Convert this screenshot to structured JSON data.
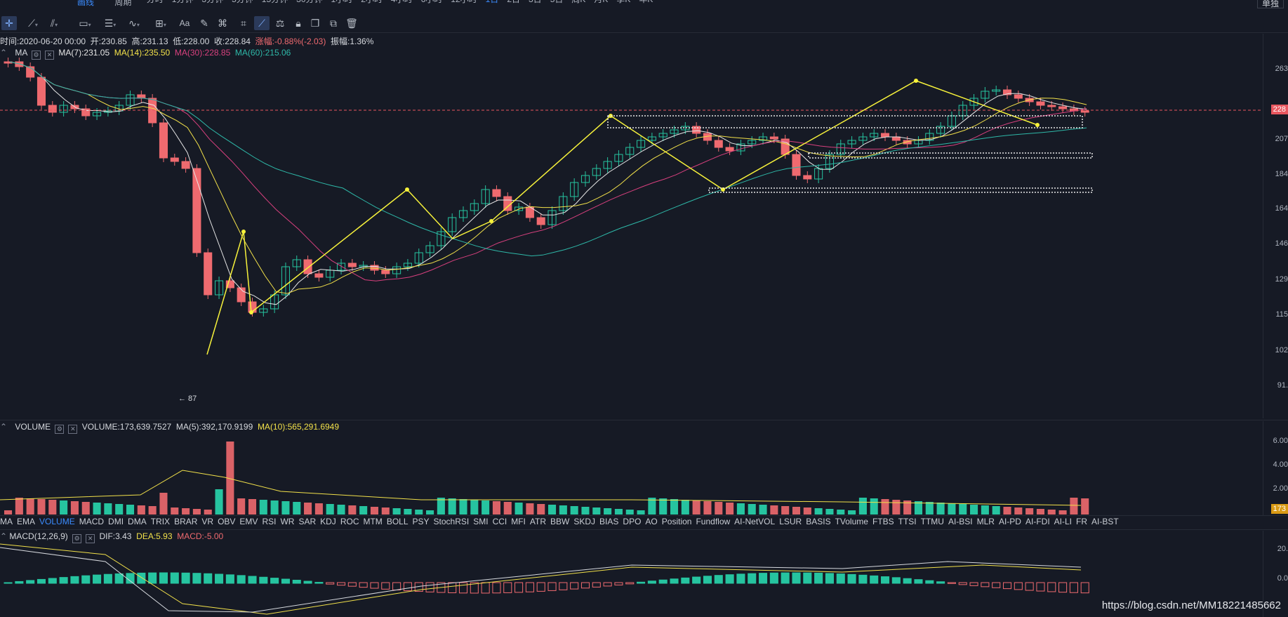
{
  "topbar": {
    "left_label": "画线",
    "period_label": "周期",
    "intervals": [
      "分时",
      "1分钟",
      "3分钟",
      "5分钟",
      "15分钟",
      "30分钟",
      "1小时",
      "2小时",
      "4小时",
      "6小时",
      "12小时",
      "1日",
      "2日",
      "3日",
      "5日",
      "周K",
      "月K",
      "季K",
      "年K"
    ],
    "active_interval": "1日",
    "right_button": "单独"
  },
  "toolbar": {
    "text_tool": "Aa"
  },
  "info": {
    "time": "时间:2020-06-20 00:00",
    "open": "开:230.85",
    "high": "高:231.13",
    "low": "低:228.00",
    "close": "收:228.84",
    "change": "涨幅:-0.88%(-2.03)",
    "amplitude": "振幅:1.36%"
  },
  "ma_line": {
    "label": "MA",
    "ma7": "MA(7):231.05",
    "ma14": "MA(14):235.50",
    "ma30": "MA(30):228.85",
    "ma60": "MA(60):215.06"
  },
  "price_axis": {
    "ticks": [
      "263",
      "228",
      "207",
      "184",
      "164",
      "146",
      "129",
      "115",
      "102",
      "91."
    ],
    "current_price": "228",
    "min_marker": "← 87"
  },
  "volume": {
    "label": "VOLUME",
    "value": "VOLUME:173,639.7527",
    "ma5": "MA(5):392,170.9199",
    "ma10": "MA(10):565,291.6949",
    "ticks": [
      "6.00",
      "4.00",
      "2.00"
    ],
    "current": "173"
  },
  "indicators": [
    "MA",
    "EMA",
    "VOLUME",
    "MACD",
    "DMI",
    "DMA",
    "TRIX",
    "BRAR",
    "VR",
    "OBV",
    "EMV",
    "RSI",
    "WR",
    "SAR",
    "KDJ",
    "ROC",
    "MTM",
    "BOLL",
    "PSY",
    "StochRSI",
    "SMI",
    "CCI",
    "MFI",
    "ATR",
    "BBW",
    "SKDJ",
    "BIAS",
    "DPO",
    "AO",
    "Position",
    "Fundflow",
    "AI-NetVOL",
    "LSUR",
    "BASIS",
    "TVolume",
    "FTBS",
    "TTSI",
    "TTMU",
    "AI-BSI",
    "MLR",
    "AI-PD",
    "AI-FDI",
    "AI-LI",
    "FR",
    "AI-BST"
  ],
  "active_indicator": "VOLUME",
  "macd": {
    "label": "MACD(12,26,9)",
    "dif": "DIF:3.43",
    "dea": "DEA:5.93",
    "macd": "MACD:-5.00",
    "ticks": [
      "20.",
      "0.0"
    ]
  },
  "watermark": "https://blog.csdn.net/MM18221485662",
  "colors": {
    "up": "#26c4a0",
    "down": "#ef6a6f",
    "ma7": "#e6e6e6",
    "ma14": "#f2e14a",
    "ma30": "#d8407e",
    "ma60": "#2eb8a8",
    "annotation": "#f7f23b",
    "accent": "#3b8cff"
  }
}
